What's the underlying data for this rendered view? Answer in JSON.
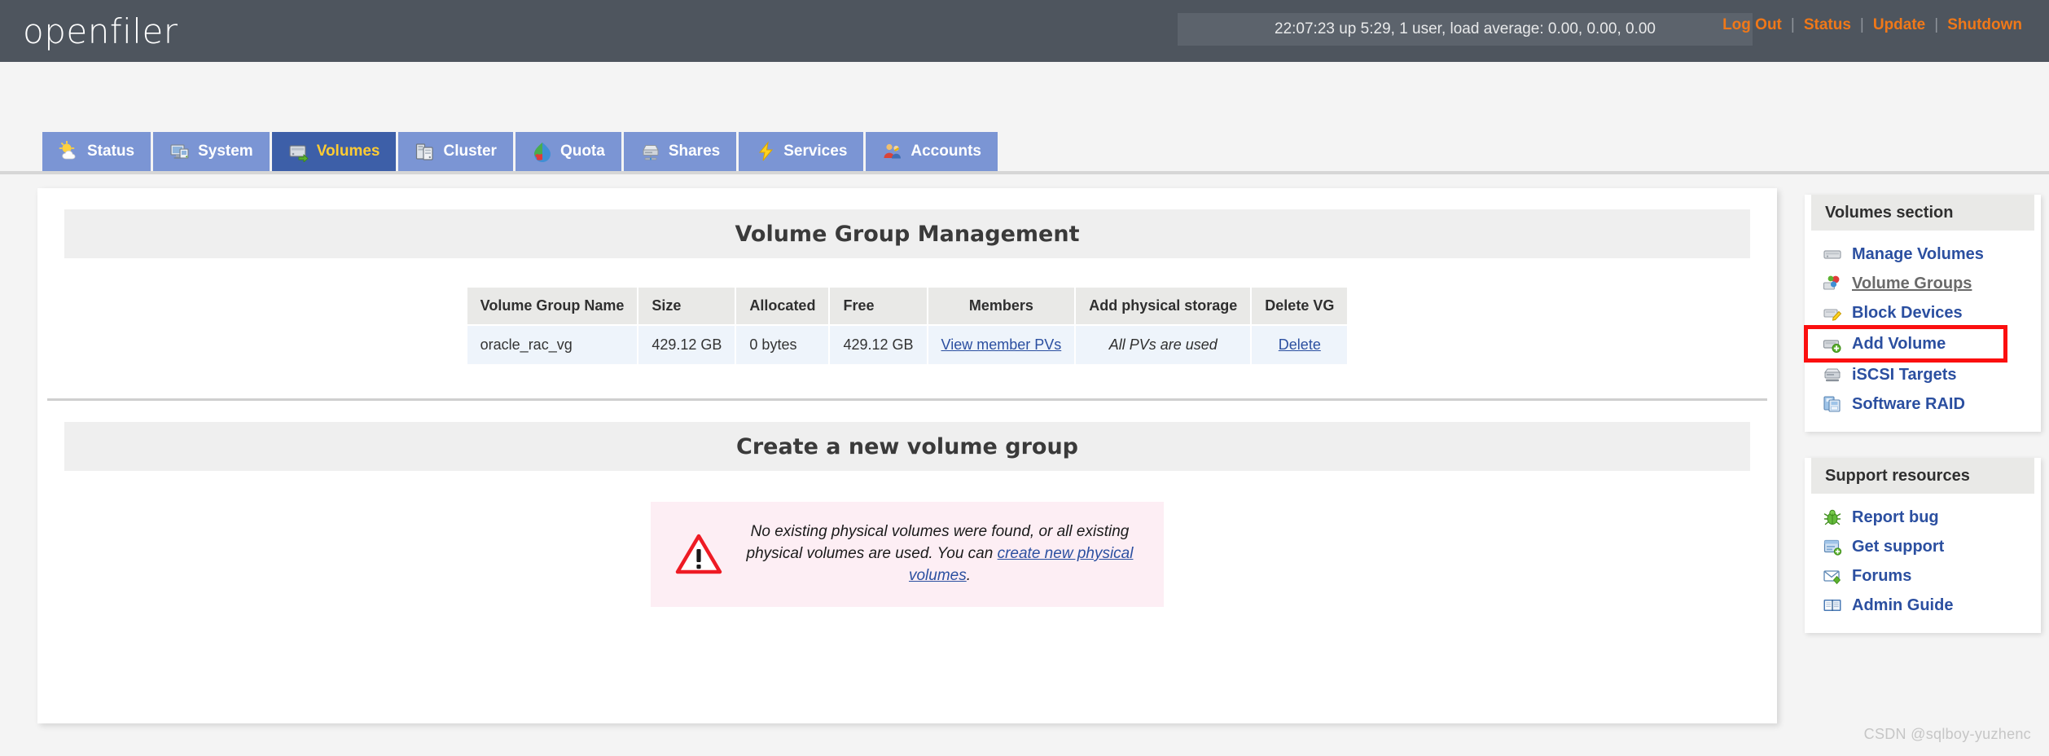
{
  "header": {
    "brand": "openfiler",
    "uptime": "22:07:23 up 5:29, 1 user, load average: 0.00, 0.00, 0.00",
    "links": [
      {
        "label": "Log Out",
        "name": "log-out"
      },
      {
        "label": "Status",
        "name": "status"
      },
      {
        "label": "Update",
        "name": "update"
      },
      {
        "label": "Shutdown",
        "name": "shutdown"
      }
    ],
    "separator": "|",
    "link_color": "#f07818",
    "bar_color": "#4e555e"
  },
  "tabs": [
    {
      "label": "Status",
      "icon": "sun-cloud-icon",
      "active": false
    },
    {
      "label": "System",
      "icon": "monitor-icon",
      "active": false
    },
    {
      "label": "Volumes",
      "icon": "volumes-icon",
      "active": true
    },
    {
      "label": "Cluster",
      "icon": "cluster-icon",
      "active": false
    },
    {
      "label": "Quota",
      "icon": "quota-icon",
      "active": false
    },
    {
      "label": "Shares",
      "icon": "shares-icon",
      "active": false
    },
    {
      "label": "Services",
      "icon": "lightning-icon",
      "active": false
    },
    {
      "label": "Accounts",
      "icon": "accounts-icon",
      "active": false
    }
  ],
  "tab_active_bg": "#3d5fa8",
  "tab_active_text": "#ffcc33",
  "main": {
    "vg_section_title": "Volume Group Management",
    "table": {
      "columns": [
        "Volume Group Name",
        "Size",
        "Allocated",
        "Free",
        "Members",
        "Add physical storage",
        "Delete VG"
      ],
      "rows": [
        {
          "name": "oracle_rac_vg",
          "size": "429.12 GB",
          "allocated": "0 bytes",
          "free": "429.12 GB",
          "members_link": "View member PVs",
          "add_storage": "All PVs are used",
          "delete_link": "Delete"
        }
      ]
    },
    "create_section_title": "Create a new volume group",
    "warning": {
      "text_before": "No existing physical volumes were found, or all existing physical volumes are used. You can ",
      "link": "create new physical volumes",
      "text_after": ".",
      "icon": "warning-triangle-icon",
      "bg_color": "#fdeef4"
    }
  },
  "sidebar": {
    "volumes_panel": {
      "title": "Volumes section",
      "items": [
        {
          "label": "Manage Volumes",
          "icon": "drive-icon",
          "current": false,
          "highlighted": false
        },
        {
          "label": "Volume Groups",
          "icon": "volume-group-icon",
          "current": true,
          "highlighted": false
        },
        {
          "label": "Block Devices",
          "icon": "block-device-icon",
          "current": false,
          "highlighted": false
        },
        {
          "label": "Add Volume",
          "icon": "add-volume-icon",
          "current": false,
          "highlighted": true
        },
        {
          "label": "iSCSI Targets",
          "icon": "iscsi-icon",
          "current": false,
          "highlighted": false
        },
        {
          "label": "Software RAID",
          "icon": "raid-icon",
          "current": false,
          "highlighted": false
        }
      ]
    },
    "support_panel": {
      "title": "Support resources",
      "items": [
        {
          "label": "Report bug",
          "icon": "bug-icon"
        },
        {
          "label": "Get support",
          "icon": "support-icon"
        },
        {
          "label": "Forums",
          "icon": "envelope-icon"
        },
        {
          "label": "Admin Guide",
          "icon": "book-icon"
        }
      ]
    },
    "highlight_color": "#fb0f0f",
    "link_color": "#2b4fa0"
  },
  "watermark": "CSDN @sqlboy-yuzhenc"
}
